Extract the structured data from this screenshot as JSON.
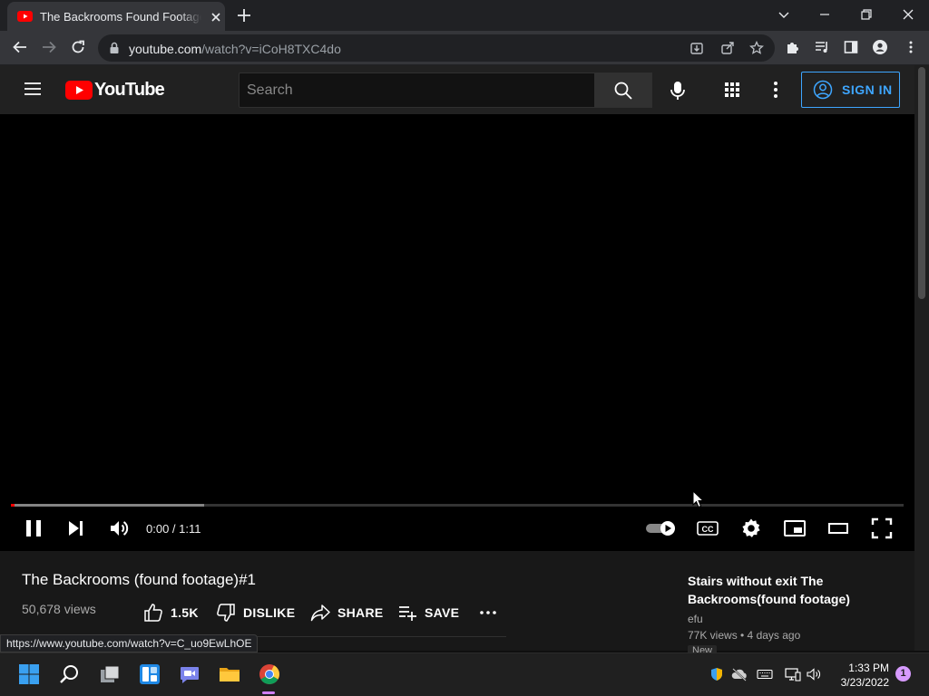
{
  "browser": {
    "tab_title": "The Backrooms Found Footage - YouTube",
    "url_host": "youtube.com",
    "url_path": "/watch?v=iCoH8TXC4do",
    "status_url": "https://www.youtube.com/watch?v=C_uo9EwLhOE"
  },
  "youtube": {
    "logo_text": "YouTube",
    "search_placeholder": "Search",
    "sign_in_label": "SIGN IN"
  },
  "player": {
    "time_current": "0:00",
    "time_separator": " / ",
    "time_duration": "1:11",
    "played_fraction": 0.004,
    "buffered_fraction": 0.216
  },
  "video": {
    "title": "The Backrooms (found footage)#1",
    "views": "50,678 views",
    "like_count": "1.5K",
    "dislike_label": "DISLIKE",
    "share_label": "SHARE",
    "save_label": "SAVE"
  },
  "recommendation": {
    "title": "Stairs without exit The Backrooms(found footage)",
    "channel": "efu",
    "meta": "77K views • 4 days ago",
    "badge": "New"
  },
  "taskbar": {
    "time": "1:33 PM",
    "date": "3/23/2022",
    "notification_count": "1"
  },
  "colors": {
    "youtube_red": "#ff0000",
    "sign_in_blue": "#3ea6ff",
    "chrome_dark": "#202124"
  }
}
